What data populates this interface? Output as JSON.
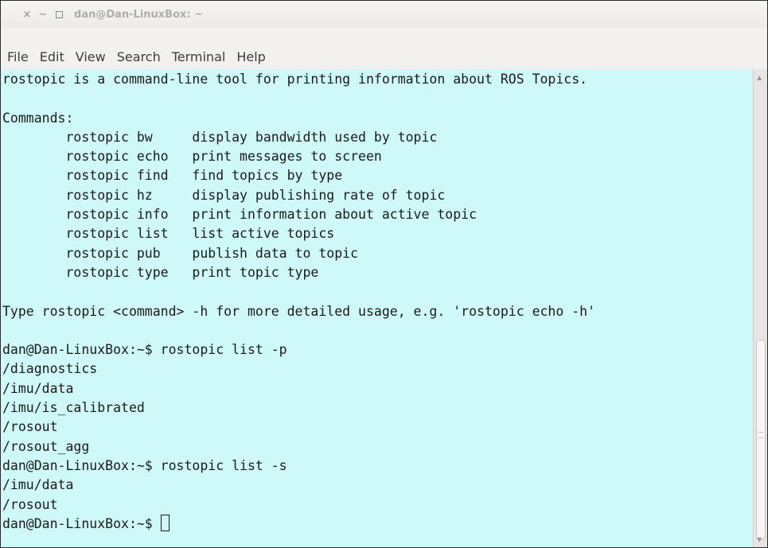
{
  "window": {
    "title": "dan@Dan-LinuxBox: ~"
  },
  "titlebar": {
    "close_glyph": "×",
    "minimize_glyph": "−"
  },
  "menubar": {
    "items": [
      {
        "label": "File"
      },
      {
        "label": "Edit"
      },
      {
        "label": "View"
      },
      {
        "label": "Search"
      },
      {
        "label": "Terminal"
      },
      {
        "label": "Help"
      }
    ]
  },
  "terminal": {
    "background_color": "#cff8f8",
    "lines": [
      "rostopic is a command-line tool for printing information about ROS Topics.",
      "",
      "Commands:",
      "\trostopic bw\tdisplay bandwidth used by topic",
      "\trostopic echo\tprint messages to screen",
      "\trostopic find\tfind topics by type",
      "\trostopic hz\tdisplay publishing rate of topic",
      "\trostopic info\tprint information about active topic",
      "\trostopic list\tlist active topics",
      "\trostopic pub\tpublish data to topic",
      "\trostopic type\tprint topic type",
      "",
      "Type rostopic <command> -h for more detailed usage, e.g. 'rostopic echo -h'",
      "",
      "dan@Dan-LinuxBox:~$ rostopic list -p",
      "/diagnostics",
      "/imu/data",
      "/imu/is_calibrated",
      "/rosout",
      "/rosout_agg",
      "dan@Dan-LinuxBox:~$ rostopic list -s",
      "/imu/data",
      "/rosout"
    ],
    "prompt": "dan@Dan-LinuxBox:~$ "
  },
  "icons": {
    "close": "close-icon",
    "minimize": "minimize-icon",
    "maximize": "maximize-icon",
    "scroll_up": "arrow-up-icon",
    "scroll_down": "arrow-down-icon"
  }
}
